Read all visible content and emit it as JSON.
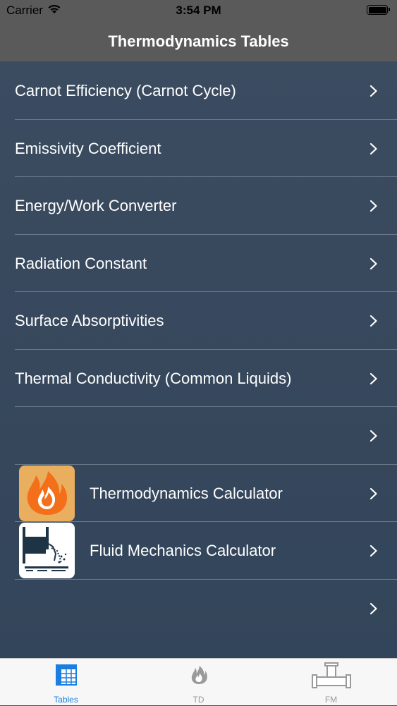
{
  "status_bar": {
    "carrier": "Carrier",
    "time": "3:54 PM"
  },
  "nav": {
    "title": "Thermodynamics Tables"
  },
  "rows": [
    {
      "label": "Carnot Efficiency (Carnot Cycle)"
    },
    {
      "label": "Emissivity Coefficient"
    },
    {
      "label": "Energy/Work Converter"
    },
    {
      "label": "Radiation Constant"
    },
    {
      "label": "Surface Absorptivities"
    },
    {
      "label": "Thermal Conductivity (Common Liquids)"
    },
    {
      "label": ""
    },
    {
      "label": "Thermodynamics Calculator",
      "icon": "flame-app-icon"
    },
    {
      "label": "Fluid Mechanics Calculator",
      "icon": "fluid-tank-app-icon"
    },
    {
      "label": ""
    }
  ],
  "tabs": [
    {
      "label": "Tables",
      "icon": "table-grid-icon",
      "selected": true
    },
    {
      "label": "TD",
      "icon": "flame-icon",
      "selected": false
    },
    {
      "label": "FM",
      "icon": "pipe-icon",
      "selected": false
    }
  ],
  "colors": {
    "nav_background": "#5a5a5a",
    "list_background": "#3a4a5e",
    "separator": "#6a7888",
    "tab_selected": "#1a7fe0",
    "tab_unselected": "#9a9a9a",
    "flame_orange": "#f36f1a",
    "flame_bg": "#e9ae5e"
  }
}
